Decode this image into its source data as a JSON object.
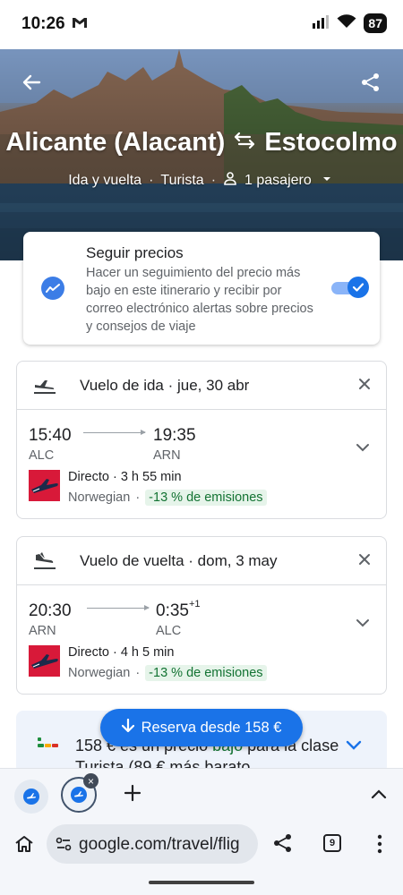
{
  "status_bar": {
    "time": "10:26",
    "battery": "87"
  },
  "hero": {
    "origin": "Alicante (Alacant)",
    "destination": "Estocolmo",
    "trip_type": "Ida y vuelta",
    "cabin": "Turista",
    "passengers": "1 pasajero"
  },
  "track_prices": {
    "title": "Seguir precios",
    "description": "Hacer un seguimiento del precio más bajo en este itinerario y recibir por correo electrónico alertas sobre precios y consejos de viaje",
    "enabled": true
  },
  "outbound": {
    "title": "Vuelo de ida · jue, 30 abr",
    "depart_time": "15:40",
    "arrive_time": "19:35",
    "depart_code": "ALC",
    "arrive_code": "ARN",
    "details": "Directo · 3 h 55 min",
    "airline": "Norwegian",
    "emissions": "-13 % de emisiones"
  },
  "return": {
    "title": "Vuelo de vuelta · dom, 3 may",
    "depart_time": "20:30",
    "arrive_time": "0:35",
    "arrive_day_offset": "+1",
    "depart_code": "ARN",
    "arrive_code": "ALC",
    "details": "Directo · 4 h 5 min",
    "airline": "Norwegian",
    "emissions": "-13 % de emisiones"
  },
  "booking": {
    "button_label": "Reserva desde 158 €"
  },
  "price_insight": {
    "before": "158 € es un precio ",
    "low": "bajo",
    "after": " para la clase Turista (89 € más barato"
  },
  "browser": {
    "url": "google.com/travel/flig",
    "tab_count": "9"
  }
}
